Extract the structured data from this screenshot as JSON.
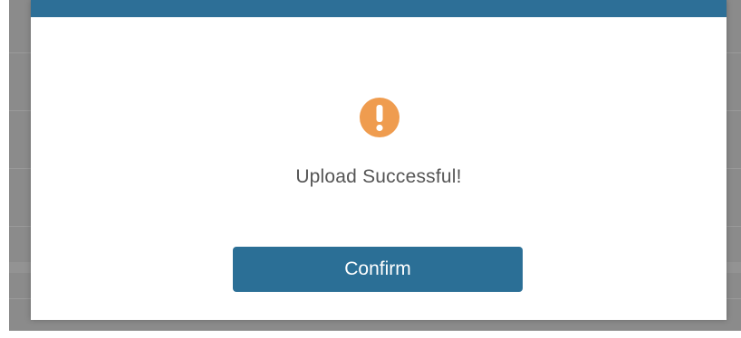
{
  "dialog": {
    "message": "Upload Successful!",
    "icon": "exclamation-circle-icon",
    "confirm_label": "Confirm"
  },
  "colors": {
    "header_bar": "#2d6f97",
    "icon": "#ef9c4f",
    "button": "#2b6f96",
    "text": "#555555",
    "overlay": "#8b8b8b"
  }
}
